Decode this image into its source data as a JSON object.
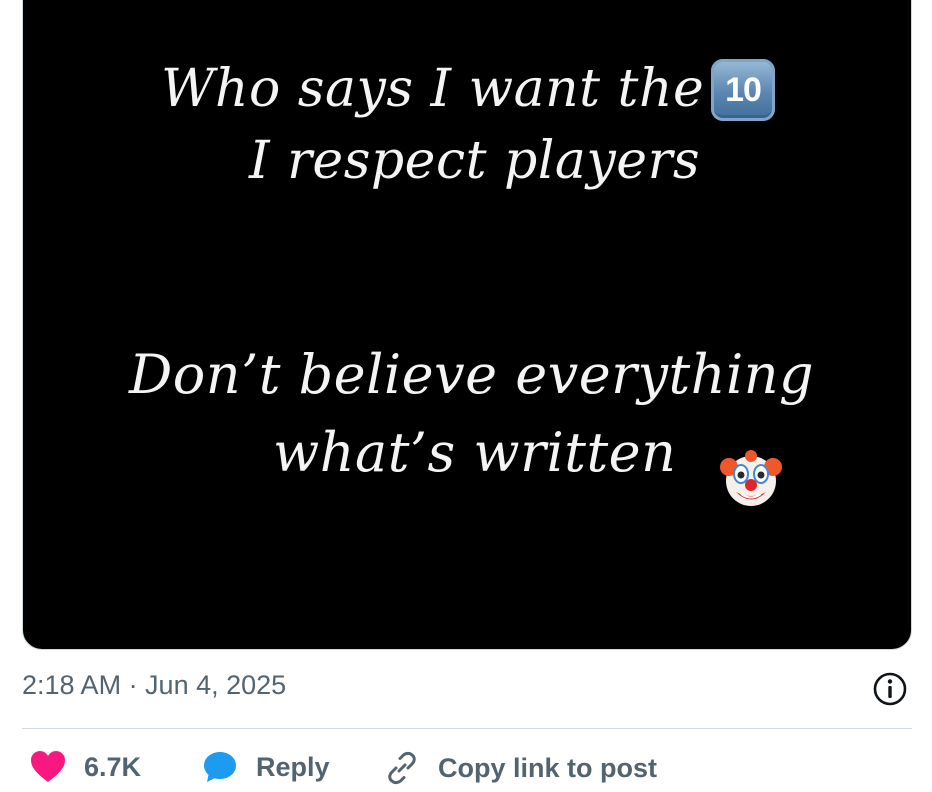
{
  "post": {
    "image_text": {
      "line1": "Who says I want the",
      "line2": "I respect players",
      "line3": "Don’t believe everything",
      "line4": "what’s written"
    },
    "keycap_emoji_label": "10",
    "timestamp": "2:18 AM · Jun 4, 2025"
  },
  "actions": {
    "like_count": "6.7K",
    "reply_label": "Reply",
    "copy_link_label": "Copy link to post"
  },
  "colors": {
    "like": "#f91880",
    "reply": "#1d9bf0",
    "muted": "#536471",
    "divider": "#cfd9de"
  },
  "icons": [
    "keycap-ten-emoji",
    "clown-face-emoji",
    "info-icon",
    "heart-icon",
    "reply-bubble-icon",
    "link-icon"
  ]
}
